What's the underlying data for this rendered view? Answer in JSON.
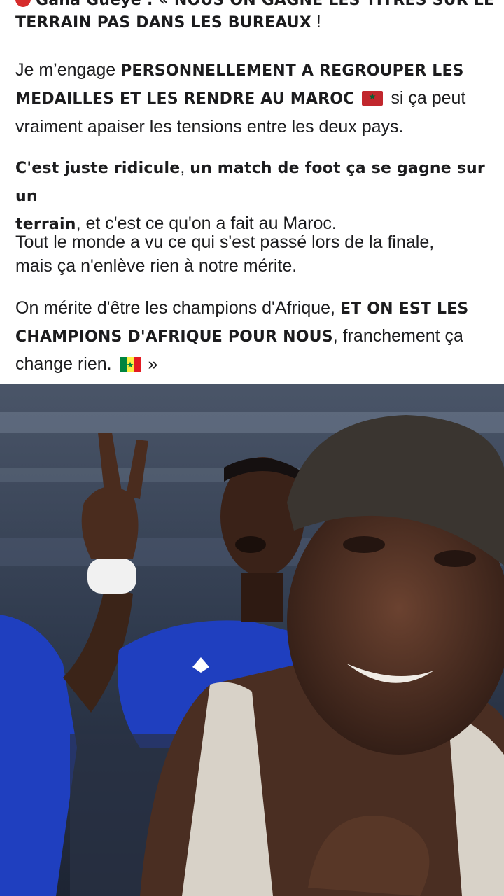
{
  "post": {
    "top_line_partial": "Gana Gueye : « NOUS ON GAGNE LES TITRES SUR LE",
    "p0_bold": "TERRAIN PAS DANS LES BUREAUX",
    "p0_tail": " !",
    "p1_pre": "Je m’engage ",
    "p1_bold_1": "PERSONNELLEMENT A REGROUPER LES",
    "p1_bold_2": "MEDAILLES ET LES RENDRE AU MAROC",
    "p1_post_flag": " si ça peut",
    "p1_line3": "vraiment apaiser les tensions entre les deux pays.",
    "p2_bold_1": "C'est juste ridicule",
    "p2_mid": ", ",
    "p2_bold_2": "un match de foot ça se gagne sur un",
    "p2_bold_3": "terrain",
    "p2_tail": ", et c'est ce qu'on a fait au Maroc.",
    "p3_line1": "Tout le monde a vu ce qui s'est passé lors de la finale,",
    "p3_line2": "mais ça n'enlève rien à notre mérite.",
    "p4_pre": "On mérite d'être les champions d'Afrique, ",
    "p4_bold_1": "ET ON EST LES",
    "p4_bold_2": "CHAMPIONS D'AFRIQUE POUR NOUS",
    "p4_mid": ", franchement ça",
    "p4_line3_pre": "change rien. ",
    "p4_end": " »"
  },
  "flags": {
    "morocco": {
      "red": "#c1272d",
      "green": "#006233"
    },
    "senegal": {
      "green": "#00853f",
      "yellow": "#fdef42",
      "red": "#e31b23"
    }
  },
  "image": {
    "description_icon": "photo-collage",
    "colors": {
      "jersey": "#1f3fbf",
      "background": "#2b3445",
      "hat": "#3a3530",
      "tank": "#d8d2c8",
      "skin": "#4a2e22"
    }
  }
}
